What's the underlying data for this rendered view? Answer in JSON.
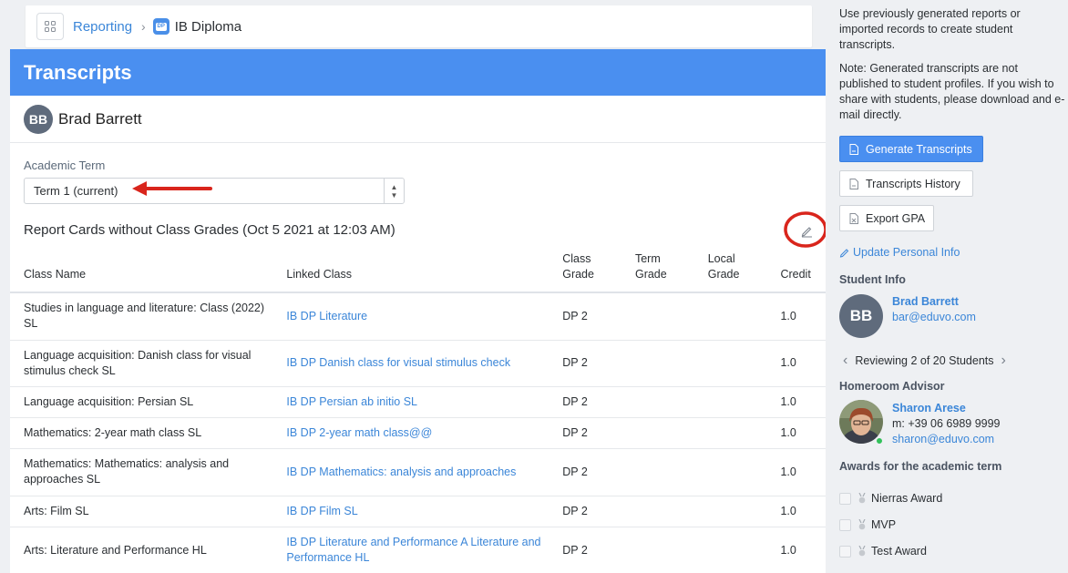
{
  "breadcrumb": {
    "parent": "Reporting",
    "badge": "DP",
    "current": "IB Diploma"
  },
  "main": {
    "title": "Transcripts",
    "student": {
      "initials": "BB",
      "name": "Brad Barrett"
    },
    "term_label": "Academic Term",
    "term_value": "Term 1 (current)",
    "report_title": "Report Cards without Class Grades (Oct 5 2021 at 12:03 AM)",
    "columns": {
      "class_name": "Class Name",
      "linked_class": "Linked Class",
      "class_grade": "Class Grade",
      "term_grade": "Term Grade",
      "local_grade": "Local Grade",
      "credit": "Credit"
    },
    "rows": [
      {
        "class_name": "Studies in language and literature: Class (2022) SL",
        "linked": "IB DP Literature",
        "class_grade": "DP 2",
        "term_grade": "",
        "local_grade": "",
        "credit": "1.0"
      },
      {
        "class_name": "Language acquisition: Danish class for visual stimulus check SL",
        "linked": "IB DP Danish class for visual stimulus check",
        "class_grade": "DP 2",
        "term_grade": "",
        "local_grade": "",
        "credit": "1.0"
      },
      {
        "class_name": "Language acquisition: Persian SL",
        "linked": "IB DP Persian ab initio SL",
        "class_grade": "DP 2",
        "term_grade": "",
        "local_grade": "",
        "credit": "1.0"
      },
      {
        "class_name": "Mathematics: 2-year math class SL",
        "linked": "IB DP 2-year math class@@",
        "class_grade": "DP 2",
        "term_grade": "",
        "local_grade": "",
        "credit": "1.0"
      },
      {
        "class_name": "Mathematics: Mathematics: analysis and approaches SL",
        "linked": "IB DP Mathematics: analysis and approaches",
        "class_grade": "DP 2",
        "term_grade": "",
        "local_grade": "",
        "credit": "1.0"
      },
      {
        "class_name": "Arts: Film SL",
        "linked": "IB DP Film SL",
        "class_grade": "DP 2",
        "term_grade": "",
        "local_grade": "",
        "credit": "1.0"
      },
      {
        "class_name": "Arts: Literature and Performance HL",
        "linked": "IB DP Literature and Performance A Literature and Performance HL",
        "class_grade": "DP 2",
        "term_grade": "",
        "local_grade": "",
        "credit": "1.0"
      }
    ]
  },
  "sidebar": {
    "intro": "Use previously generated reports or imported records to create student transcripts.",
    "note": "Note: Generated transcripts are not published to student profiles. If you wish to share with students, please download and e-mail directly.",
    "generate_label": "Generate Transcripts",
    "history_label": "Transcripts History",
    "export_label": "Export GPA",
    "update_label": "Update Personal Info",
    "student_info_title": "Student Info",
    "student_initials": "BB",
    "student_name": "Brad Barrett",
    "student_email": "bar@eduvo.com",
    "reviewing": "Reviewing 2 of 20 Students",
    "advisor_title": "Homeroom Advisor",
    "advisor_name": "Sharon Arese",
    "advisor_phone": "m: +39 06 6989 9999",
    "advisor_email": "sharon@eduvo.com",
    "awards_title": "Awards for the academic term",
    "awards": [
      "Nierras Award",
      "MVP",
      "Test Award"
    ]
  },
  "colors": {
    "accent": "#4a8ff0",
    "link": "#3b86d8",
    "annotation": "#d9251c",
    "online": "#32c15a"
  },
  "icons": [
    "grid-icon",
    "chevron-right-icon",
    "ib-badge-icon",
    "pencil-icon",
    "pdf-icon",
    "excel-icon",
    "chevron-left-icon",
    "medal-icon",
    "arrow-annotation",
    "circle-annotation"
  ]
}
